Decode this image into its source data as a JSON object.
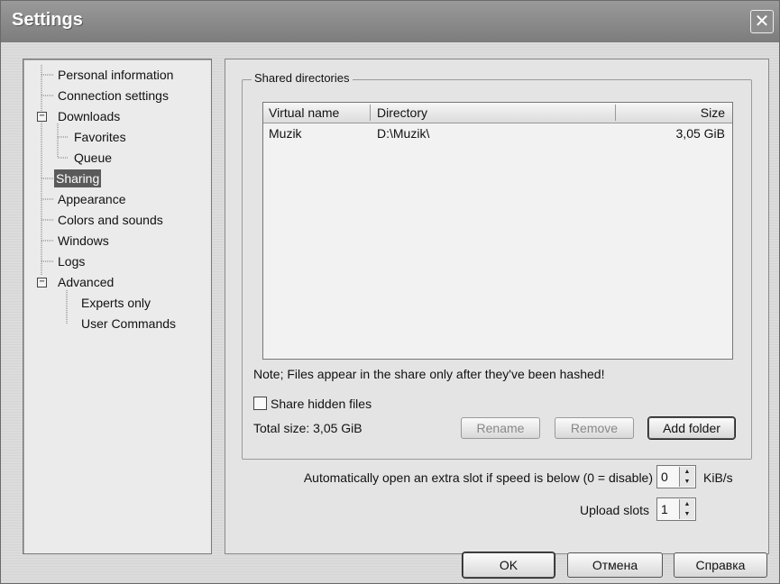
{
  "window": {
    "title": "Settings",
    "close_glyph": "✕"
  },
  "tree": {
    "items": [
      {
        "label": "Personal information"
      },
      {
        "label": "Connection settings"
      },
      {
        "label": "Downloads"
      },
      {
        "label": "Favorites"
      },
      {
        "label": "Queue"
      },
      {
        "label": "Sharing",
        "selected": true
      },
      {
        "label": "Appearance"
      },
      {
        "label": "Colors and sounds"
      },
      {
        "label": "Windows"
      },
      {
        "label": "Logs"
      },
      {
        "label": "Advanced"
      },
      {
        "label": "Experts only"
      },
      {
        "label": "User Commands"
      }
    ],
    "expander_glyph": "−"
  },
  "sharing": {
    "group_label": "Shared directories",
    "columns": [
      "Virtual name",
      "Directory",
      "Size"
    ],
    "rows": [
      {
        "virtual_name": "Muzik",
        "directory": "D:\\Muzik\\",
        "size": "3,05 GiB"
      }
    ],
    "note": "Note; Files appear in the share only after they've been hashed!",
    "share_hidden_label": "Share hidden files",
    "share_hidden_checked": false,
    "total_size": "Total size:  3,05 GiB",
    "buttons": {
      "rename": "Rename",
      "remove": "Remove",
      "add_folder": "Add folder"
    },
    "extra_slot_label": "Automatically open an extra slot if speed is below (0 = disable)",
    "extra_slot_value": "0",
    "extra_slot_unit": "KiB/s",
    "upload_slots_label": "Upload slots",
    "upload_slots_value": "1"
  },
  "footer": {
    "ok": "OK",
    "cancel": "Отмена",
    "help": "Справка"
  },
  "spin_up": "▲",
  "spin_down": "▼"
}
